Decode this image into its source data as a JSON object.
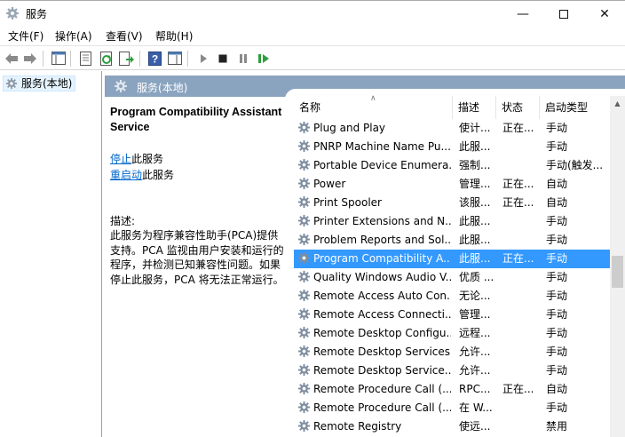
{
  "window": {
    "title": "服务"
  },
  "menu": [
    "文件(F)",
    "操作(A)",
    "查看(V)",
    "帮助(H)"
  ],
  "tree": {
    "item": "服务(本地)"
  },
  "content": {
    "header": "服务(本地)"
  },
  "details": {
    "service_name": "Program Compatibility Assistant Service",
    "stop_link": "停止",
    "stop_suffix": "此服务",
    "restart_link": "重启动",
    "restart_suffix": "此服务",
    "desc_label": "描述:",
    "desc_text": "此服务为程序兼容性助手(PCA)提供支持。PCA 监视由用户安装和运行的程序，并检测已知兼容性问题。如果停止此服务，PCA 将无法正常运行。"
  },
  "list": {
    "columns": [
      "名称",
      "描述",
      "状态",
      "启动类型"
    ],
    "selected_index": 7,
    "rows": [
      {
        "name": "Plug and Play",
        "desc": "使计...",
        "status": "正在...",
        "startup": "手动"
      },
      {
        "name": "PNRP Machine Name Pu...",
        "desc": "此服...",
        "status": "",
        "startup": "手动"
      },
      {
        "name": "Portable Device Enumera...",
        "desc": "强制...",
        "status": "",
        "startup": "手动(触发..."
      },
      {
        "name": "Power",
        "desc": "管理...",
        "status": "正在...",
        "startup": "自动"
      },
      {
        "name": "Print Spooler",
        "desc": "该服...",
        "status": "正在...",
        "startup": "自动"
      },
      {
        "name": "Printer Extensions and N...",
        "desc": "此服...",
        "status": "",
        "startup": "手动"
      },
      {
        "name": "Problem Reports and Sol...",
        "desc": "此服...",
        "status": "",
        "startup": "手动"
      },
      {
        "name": "Program Compatibility A...",
        "desc": "此服...",
        "status": "正在...",
        "startup": "手动"
      },
      {
        "name": "Quality Windows Audio V...",
        "desc": "优质 ...",
        "status": "",
        "startup": "手动"
      },
      {
        "name": "Remote Access Auto Con...",
        "desc": "无论...",
        "status": "",
        "startup": "手动"
      },
      {
        "name": "Remote Access Connecti...",
        "desc": "管理...",
        "status": "",
        "startup": "手动"
      },
      {
        "name": "Remote Desktop Configu...",
        "desc": "远程...",
        "status": "",
        "startup": "手动"
      },
      {
        "name": "Remote Desktop Services",
        "desc": "允许...",
        "status": "",
        "startup": "手动"
      },
      {
        "name": "Remote Desktop Service...",
        "desc": "允许...",
        "status": "",
        "startup": "手动"
      },
      {
        "name": "Remote Procedure Call (...",
        "desc": "RPC...",
        "status": "正在...",
        "startup": "自动"
      },
      {
        "name": "Remote Procedure Call (...",
        "desc": "在 W...",
        "status": "",
        "startup": "手动"
      },
      {
        "name": "Remote Registry",
        "desc": "使远...",
        "status": "",
        "startup": "禁用"
      }
    ]
  },
  "colors": {
    "header_bar": "#8aa3bf",
    "selection": "#3399ff",
    "link": "#0066cc"
  },
  "icons": [
    "services-gear-icon",
    "minimize-icon",
    "maximize-icon",
    "close-icon",
    "back-arrow-icon",
    "forward-arrow-icon",
    "console-tree-icon",
    "properties-icon",
    "refresh-icon",
    "export-list-icon",
    "help-icon",
    "show-hide-pane-icon",
    "start-icon",
    "stop-icon",
    "pause-icon",
    "resume-icon"
  ]
}
